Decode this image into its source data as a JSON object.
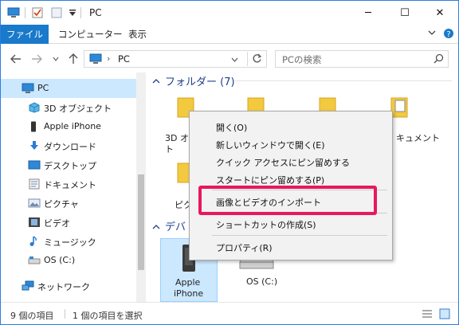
{
  "window": {
    "title": "PC",
    "controls": {
      "minimize": "─",
      "maximize": "☐",
      "close": "✕"
    }
  },
  "ribbon": {
    "tabs": [
      {
        "label": "ファイル"
      },
      {
        "label": "コンピューター"
      },
      {
        "label": "表示"
      }
    ]
  },
  "address": {
    "path": "PC",
    "path_sep": "›",
    "search_placeholder": "PCの検索"
  },
  "sidebar": {
    "items": [
      {
        "label": "PC",
        "icon": "pc-icon"
      },
      {
        "label": "3D オブジェクト",
        "icon": "3d-objects-icon"
      },
      {
        "label": "Apple iPhone",
        "icon": "iphone-icon"
      },
      {
        "label": "ダウンロード",
        "icon": "download-icon"
      },
      {
        "label": "デスクトップ",
        "icon": "desktop-icon"
      },
      {
        "label": "ドキュメント",
        "icon": "documents-icon"
      },
      {
        "label": "ピクチャ",
        "icon": "pictures-icon"
      },
      {
        "label": "ビデオ",
        "icon": "videos-icon"
      },
      {
        "label": "ミュージック",
        "icon": "music-icon"
      },
      {
        "label": "OS (C:)",
        "icon": "drive-icon"
      },
      {
        "label": "ネットワーク",
        "icon": "network-icon"
      }
    ]
  },
  "main": {
    "folders_header": "フォルダー (7)",
    "devices_header": "デバ",
    "folder_labels": {
      "f1_line1": "3D オ",
      "f1_line2": "ト",
      "f4": "キュメント",
      "f5": "ピク"
    },
    "devices": [
      {
        "label_line1": "Apple",
        "label_line2": "iPhone"
      },
      {
        "label": "OS (C:)"
      }
    ]
  },
  "context_menu": {
    "items": [
      "開く(O)",
      "新しいウィンドウで開く(E)",
      "クイック アクセスにピン留めする",
      "スタートにピン留めする(P)",
      "画像とビデオのインポート",
      "ショートカットの作成(S)",
      "プロパティ(R)"
    ],
    "highlight_color": "#e8185f"
  },
  "status": {
    "item_count": "9 個の項目",
    "selected": "1 個の項目を選択"
  },
  "colors": {
    "accent": "#1979ca",
    "selected": "#cce8ff",
    "highlight": "#e8185f"
  }
}
